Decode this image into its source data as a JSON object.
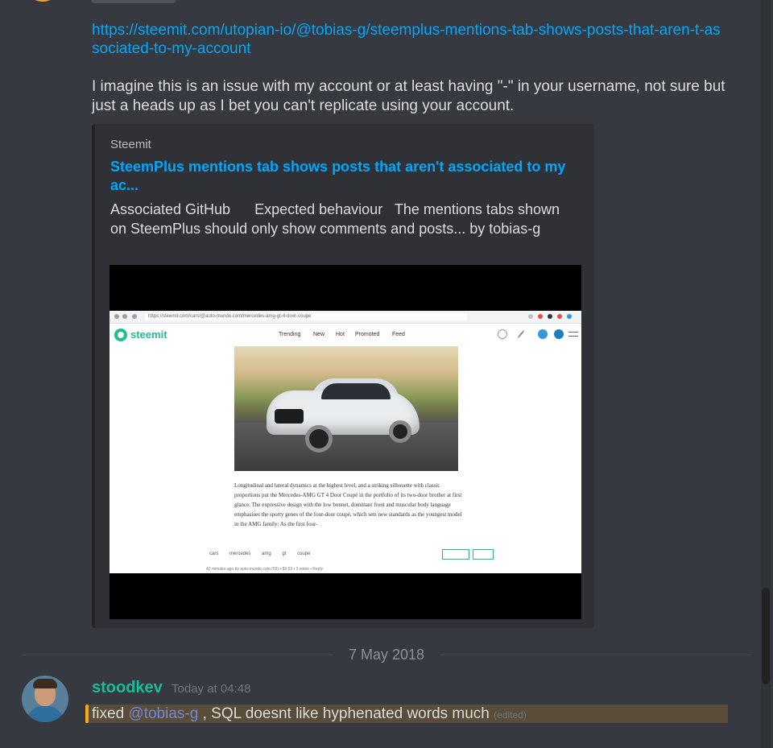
{
  "previous_message": {
    "link": "https://steemit.com/utopian-io/@tobias-g/steemplus-mentions-tab-shows-posts-that-aren-t-associated-to-my-account",
    "text": "I imagine this is an issue with my account or at least having \"-\" in your username, not sure but just a heads up as I bet you can't replicate using your account.",
    "embed": {
      "provider": "Steemit",
      "title": "SteemPlus mentions tab shows posts that aren't associated to my ac...",
      "description": "Associated GitHub      Expected behaviour   The mentions tabs shown on SteemPlus should only show comments and posts... by tobias-g",
      "image": {
        "browser_url": "https://steemit.com/cars/@auto-mundo.com/mercedes-amg-gt-4-door-coupe",
        "site_name": "steemit",
        "nav": [
          "Trending",
          "New",
          "Hot",
          "Promoted",
          "Feed"
        ],
        "article_text": "Longitudinal and lateral dynamics at the highest level, and a striking silhouette with classic proportions put the Mercedes-AMG GT 4 Door Coupé in the portfolio of its two-door brother at first glance. The expressive design with the low bonnet, dominant front and muscular body language emphasises the sporty genes of the four-door coupé, which sets new standards as the youngest model in the AMG family: As the first four-",
        "tags": [
          "cars",
          "mercedes",
          "amg",
          "gt",
          "coupe"
        ],
        "footer": "42 minutes ago by auto-mundo.com (55)  •  $3.53  •  3 votes  •  Reply"
      }
    }
  },
  "date_divider": "7 May 2018",
  "message": {
    "username": "stoodkev",
    "timestamp": "Today at 04:48",
    "text_before": "fixed ",
    "mention": "@tobias-g",
    "text_after": " , SQL doesnt like hyphenated words much",
    "edited": "(edited)"
  },
  "colors": {
    "background": "#36393f",
    "link": "#00a8fc",
    "username": "#1abc9c",
    "mention": "#7289da",
    "highlight": "#faa81a"
  }
}
